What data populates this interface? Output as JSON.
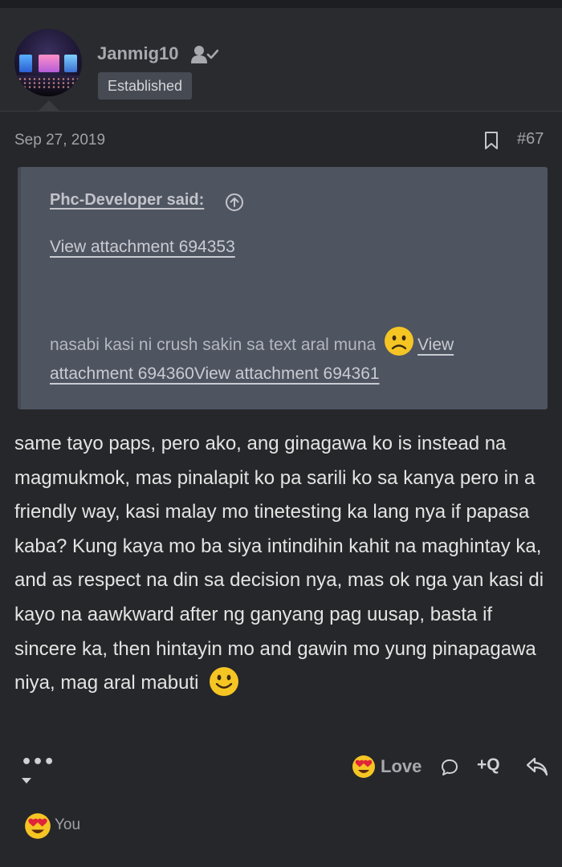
{
  "post": {
    "author": "Janmig10",
    "user_title": "Established",
    "date": "Sep 27, 2019",
    "number": "#67",
    "icons": {
      "avatar": "avatar-concert-image",
      "user_status": "user-check-icon",
      "bookmark": "bookmark-icon"
    }
  },
  "quote": {
    "author_said": "Phc-Developer said:",
    "icon": "arrow-up-circle-icon",
    "attachment_1": "View attachment 694353",
    "text": "nasabi kasi ni crush sakin sa text aral muna",
    "emoji": "sad-face-emoji",
    "attachment_2_part1": "View",
    "attachment_2_part2": "attachment 694360",
    "attachment_3": "View attachment 694361"
  },
  "message": {
    "text": "same tayo paps, pero ako, ang ginagawa ko is instead na magmukmok, mas pinalapit ko pa sarili ko sa kanya pero in a friendly way, kasi malay mo tinetesting ka lang nya if papasa kaba? Kung kaya mo ba siya intindihin kahit na maghintay ka, and as respect na din sa decision nya, mas ok nga yan kasi di kayo na aawkward after ng ganyang pag uusap, basta if sincere ka, then hintayin mo and gawin mo yung pinapagawa niya, mag aral mabuti",
    "emoji": "smile-emoji"
  },
  "actions": {
    "more_label": "•••",
    "love_label": "Love",
    "multiquote_label": "+Q",
    "icons": {
      "more": "chevron-down-icon",
      "love": "heart-eyes-emoji",
      "comment": "comment-icon",
      "reply": "reply-icon"
    }
  },
  "reactions": {
    "label": "You",
    "emoji": "heart-eyes-emoji"
  },
  "colors": {
    "background": "#26272a",
    "quote_background": "#4f5461",
    "badge_background": "#464a52",
    "emoji_yellow": "#f5c524",
    "heart_red": "#e0243a"
  }
}
